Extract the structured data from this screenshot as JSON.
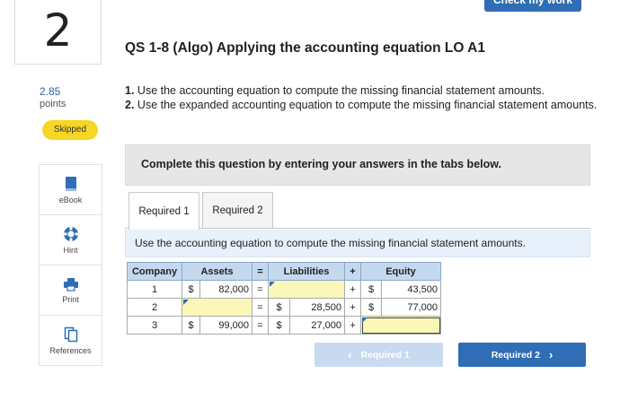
{
  "header": {
    "question_number": "2",
    "check_button": "Check my work"
  },
  "sidebar": {
    "points_value": "2.85",
    "points_label": "points",
    "status_badge": "Skipped",
    "tools": [
      {
        "label": "eBook",
        "icon": "book-icon"
      },
      {
        "label": "Hint",
        "icon": "lifebuoy-icon"
      },
      {
        "label": "Print",
        "icon": "printer-icon"
      },
      {
        "label": "References",
        "icon": "documents-icon"
      }
    ]
  },
  "question": {
    "title": "QS 1-8 (Algo) Applying the accounting equation LO A1",
    "instr1_num": "1.",
    "instr1_text": " Use the accounting equation to compute the missing financial statement amounts.",
    "instr2_num": "2.",
    "instr2_text": " Use the expanded accounting equation to compute the missing financial statement amounts.",
    "banner": "Complete this question by entering your answers in the tabs below."
  },
  "tabs": [
    {
      "label": "Required 1",
      "active": true
    },
    {
      "label": "Required 2",
      "active": false
    }
  ],
  "sub_instruction": "Use the accounting equation to compute the missing financial statement amounts.",
  "table": {
    "headers": {
      "company": "Company",
      "assets": "Assets",
      "eq": "=",
      "liabilities": "Liabilities",
      "plus": "+",
      "equity": "Equity"
    },
    "rows": [
      {
        "company": "1",
        "assets_unit": "$",
        "assets": "82,000",
        "eq": "=",
        "liab_unit": "",
        "liabilities": "",
        "plus": "+",
        "equity_unit": "$",
        "equity": "43,500"
      },
      {
        "company": "2",
        "assets_unit": "",
        "assets": "",
        "eq": "=",
        "liab_unit": "$",
        "liabilities": "28,500",
        "plus": "+",
        "equity_unit": "$",
        "equity": "77,000"
      },
      {
        "company": "3",
        "assets_unit": "$",
        "assets": "99,000",
        "eq": "=",
        "liab_unit": "$",
        "liabilities": "27,000",
        "plus": "+",
        "equity_unit": "",
        "equity": ""
      }
    ]
  },
  "nav": {
    "prev_label": "Required 1",
    "prev_chevron": "‹",
    "next_label": "Required 2",
    "next_chevron": "›"
  },
  "colors": {
    "accent": "#2f6db5",
    "badge": "#f6d626",
    "input_fill": "#fbf7b8",
    "header_fill": "#c4d9ef"
  }
}
